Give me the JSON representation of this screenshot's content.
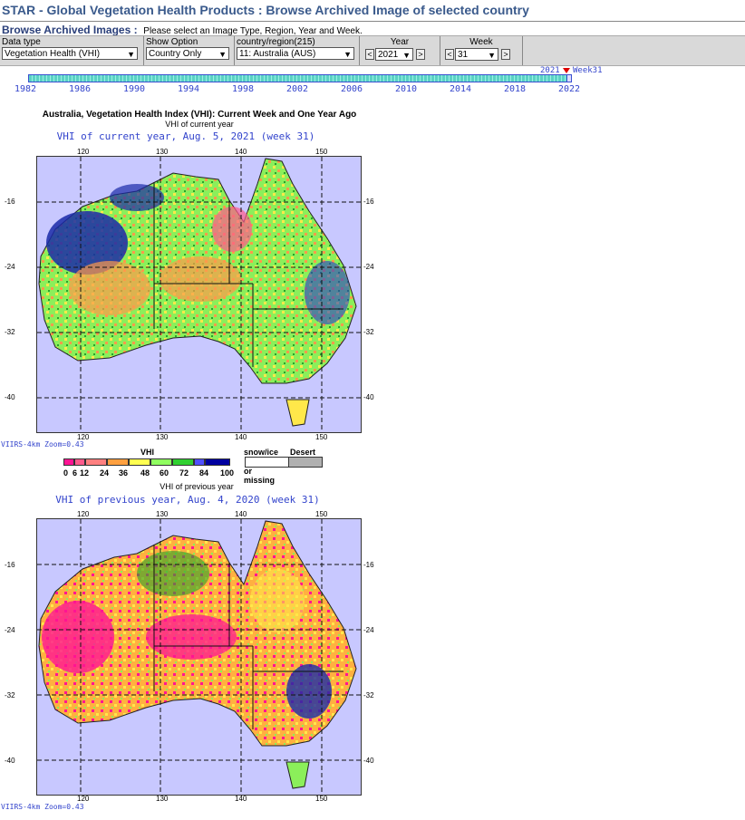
{
  "header": {
    "title": "STAR - Global Vegetation Health Products : Browse Archived Image of selected country",
    "browse_label": "Browse Archived Images :",
    "instruction": "Please select an Image Type, Region, Year and Week."
  },
  "controls": {
    "data_type": {
      "label": "Data type",
      "value": "Vegetation Health (VHI)"
    },
    "show_option": {
      "label": "Show Option",
      "value": "Country Only"
    },
    "country": {
      "label": "country/region(215)",
      "value": "11: Australia (AUS)"
    },
    "year": {
      "label": "Year",
      "value": "2021",
      "prev": "<",
      "next": ">"
    },
    "week": {
      "label": "Week",
      "value": "31",
      "prev": "<",
      "next": ">"
    }
  },
  "timeline": {
    "ticks": [
      "1982",
      "1986",
      "1990",
      "1994",
      "1998",
      "2002",
      "2006",
      "2010",
      "2014",
      "2018",
      "2022"
    ],
    "current_year": "2021",
    "current_week": "Week31"
  },
  "figure": {
    "title": "Australia, Vegetation Health Index (VHI): Current Week and One Year Ago",
    "current_sub": "VHI of current year",
    "current_caption": "VHI of current year, Aug. 5, 2021 (week 31)",
    "previous_sub": "VHI of previous year",
    "previous_caption": "VHI of previous year, Aug. 4, 2020 (week 31)",
    "zoom_note": "VIIRS-4km Zoom=0.43",
    "lon_labels": [
      "120",
      "130",
      "140",
      "150"
    ],
    "lat_labels": [
      "-16",
      "-24",
      "-32",
      "-40"
    ]
  },
  "legend": {
    "title": "VHI",
    "values": [
      "0",
      "6",
      "12",
      "24",
      "36",
      "48",
      "60",
      "72",
      "84",
      "100"
    ],
    "colors": [
      "#ff1493",
      "#ff5a8c",
      "#ff8080",
      "#ffa040",
      "#ffff50",
      "#90ff60",
      "#30d030",
      "#5050ff",
      "#0000a0"
    ],
    "snow_label": "snow/ice",
    "missing_label": "or missing",
    "desert_label": "Desert"
  }
}
